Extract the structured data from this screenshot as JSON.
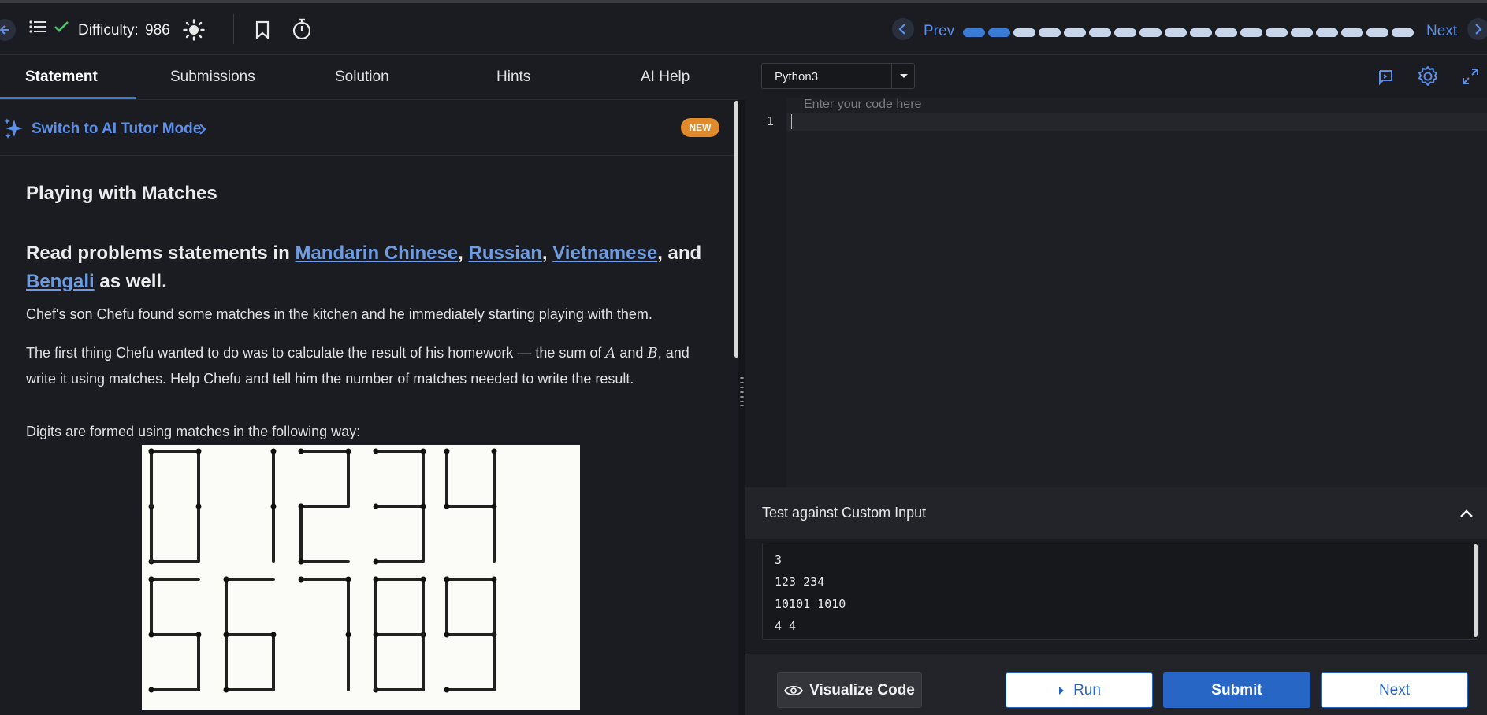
{
  "topbar": {
    "difficulty_label": "Difficulty:",
    "difficulty_value": "986",
    "prev_label": "Prev",
    "next_label": "Next",
    "progress": {
      "total_segments": 18,
      "completed_segments": 2,
      "completed_color": "#3a7bd5",
      "pending_color": "#c9d6ea"
    }
  },
  "tabs": [
    {
      "label": "Statement",
      "active": true
    },
    {
      "label": "Submissions",
      "active": false
    },
    {
      "label": "Solution",
      "active": false
    },
    {
      "label": "Hints",
      "active": false
    },
    {
      "label": "AI Help",
      "active": false
    }
  ],
  "ai_tutor": {
    "link_label": "Switch to AI Tutor Mode",
    "badge": "NEW"
  },
  "problem": {
    "title": "Playing with Matches",
    "subtitle_prefix": "Read problems statements in",
    "languages": [
      "Mandarin Chinese",
      "Russian",
      "Vietnamese",
      "Bengali"
    ],
    "sep1": ",",
    "sep2": ",",
    "sep3": ", and",
    "subtitle_suffix": "as well.",
    "para1": "Chef's son Chefu found some matches in the kitchen and he immediately starting playing with them.",
    "para2_a": "The first thing Chefu wanted to do was to calculate the result of his homework — the sum of",
    "var_a": "A",
    "para2_and": "and",
    "var_b": "B",
    "para2_comma": ",",
    "para2_b": "and write it using matches. Help Chefu and tell him the number of matches needed to write the result.",
    "para3": "Digits are formed using matches in the following way:"
  },
  "editor": {
    "language": "Python3",
    "placeholder": "Enter your code here",
    "line_number": "1"
  },
  "custom_input": {
    "title": "Test against Custom Input",
    "lines": [
      "3",
      "123 234",
      "10101 1010",
      "4 4"
    ]
  },
  "buttons": {
    "visualize": "Visualize Code",
    "run": "Run",
    "submit": "Submit",
    "next": "Next"
  },
  "colors": {
    "accent": "#3a7bd5",
    "link": "#6f9be0",
    "badge": "#e08a2b",
    "submit": "#2766c4"
  }
}
